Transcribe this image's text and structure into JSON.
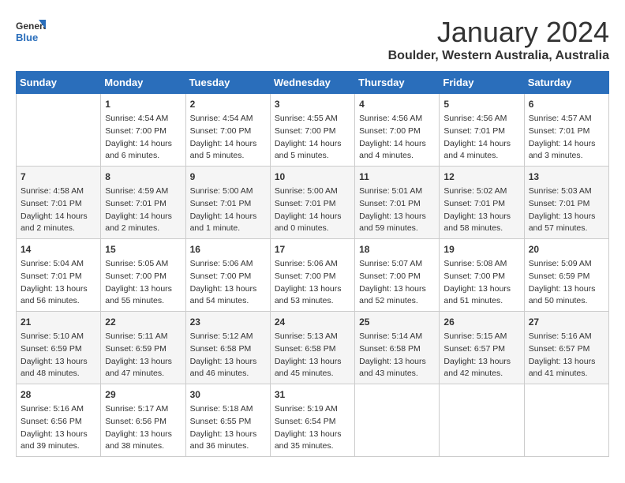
{
  "logo": {
    "line1": "General",
    "line2": "Blue"
  },
  "title": "January 2024",
  "location": "Boulder, Western Australia, Australia",
  "days_of_week": [
    "Sunday",
    "Monday",
    "Tuesday",
    "Wednesday",
    "Thursday",
    "Friday",
    "Saturday"
  ],
  "weeks": [
    [
      {
        "day": "",
        "info": ""
      },
      {
        "day": "1",
        "info": "Sunrise: 4:54 AM\nSunset: 7:00 PM\nDaylight: 14 hours\nand 6 minutes."
      },
      {
        "day": "2",
        "info": "Sunrise: 4:54 AM\nSunset: 7:00 PM\nDaylight: 14 hours\nand 5 minutes."
      },
      {
        "day": "3",
        "info": "Sunrise: 4:55 AM\nSunset: 7:00 PM\nDaylight: 14 hours\nand 5 minutes."
      },
      {
        "day": "4",
        "info": "Sunrise: 4:56 AM\nSunset: 7:00 PM\nDaylight: 14 hours\nand 4 minutes."
      },
      {
        "day": "5",
        "info": "Sunrise: 4:56 AM\nSunset: 7:01 PM\nDaylight: 14 hours\nand 4 minutes."
      },
      {
        "day": "6",
        "info": "Sunrise: 4:57 AM\nSunset: 7:01 PM\nDaylight: 14 hours\nand 3 minutes."
      }
    ],
    [
      {
        "day": "7",
        "info": "Sunrise: 4:58 AM\nSunset: 7:01 PM\nDaylight: 14 hours\nand 2 minutes."
      },
      {
        "day": "8",
        "info": "Sunrise: 4:59 AM\nSunset: 7:01 PM\nDaylight: 14 hours\nand 2 minutes."
      },
      {
        "day": "9",
        "info": "Sunrise: 5:00 AM\nSunset: 7:01 PM\nDaylight: 14 hours\nand 1 minute."
      },
      {
        "day": "10",
        "info": "Sunrise: 5:00 AM\nSunset: 7:01 PM\nDaylight: 14 hours\nand 0 minutes."
      },
      {
        "day": "11",
        "info": "Sunrise: 5:01 AM\nSunset: 7:01 PM\nDaylight: 13 hours\nand 59 minutes."
      },
      {
        "day": "12",
        "info": "Sunrise: 5:02 AM\nSunset: 7:01 PM\nDaylight: 13 hours\nand 58 minutes."
      },
      {
        "day": "13",
        "info": "Sunrise: 5:03 AM\nSunset: 7:01 PM\nDaylight: 13 hours\nand 57 minutes."
      }
    ],
    [
      {
        "day": "14",
        "info": "Sunrise: 5:04 AM\nSunset: 7:01 PM\nDaylight: 13 hours\nand 56 minutes."
      },
      {
        "day": "15",
        "info": "Sunrise: 5:05 AM\nSunset: 7:00 PM\nDaylight: 13 hours\nand 55 minutes."
      },
      {
        "day": "16",
        "info": "Sunrise: 5:06 AM\nSunset: 7:00 PM\nDaylight: 13 hours\nand 54 minutes."
      },
      {
        "day": "17",
        "info": "Sunrise: 5:06 AM\nSunset: 7:00 PM\nDaylight: 13 hours\nand 53 minutes."
      },
      {
        "day": "18",
        "info": "Sunrise: 5:07 AM\nSunset: 7:00 PM\nDaylight: 13 hours\nand 52 minutes."
      },
      {
        "day": "19",
        "info": "Sunrise: 5:08 AM\nSunset: 7:00 PM\nDaylight: 13 hours\nand 51 minutes."
      },
      {
        "day": "20",
        "info": "Sunrise: 5:09 AM\nSunset: 6:59 PM\nDaylight: 13 hours\nand 50 minutes."
      }
    ],
    [
      {
        "day": "21",
        "info": "Sunrise: 5:10 AM\nSunset: 6:59 PM\nDaylight: 13 hours\nand 48 minutes."
      },
      {
        "day": "22",
        "info": "Sunrise: 5:11 AM\nSunset: 6:59 PM\nDaylight: 13 hours\nand 47 minutes."
      },
      {
        "day": "23",
        "info": "Sunrise: 5:12 AM\nSunset: 6:58 PM\nDaylight: 13 hours\nand 46 minutes."
      },
      {
        "day": "24",
        "info": "Sunrise: 5:13 AM\nSunset: 6:58 PM\nDaylight: 13 hours\nand 45 minutes."
      },
      {
        "day": "25",
        "info": "Sunrise: 5:14 AM\nSunset: 6:58 PM\nDaylight: 13 hours\nand 43 minutes."
      },
      {
        "day": "26",
        "info": "Sunrise: 5:15 AM\nSunset: 6:57 PM\nDaylight: 13 hours\nand 42 minutes."
      },
      {
        "day": "27",
        "info": "Sunrise: 5:16 AM\nSunset: 6:57 PM\nDaylight: 13 hours\nand 41 minutes."
      }
    ],
    [
      {
        "day": "28",
        "info": "Sunrise: 5:16 AM\nSunset: 6:56 PM\nDaylight: 13 hours\nand 39 minutes."
      },
      {
        "day": "29",
        "info": "Sunrise: 5:17 AM\nSunset: 6:56 PM\nDaylight: 13 hours\nand 38 minutes."
      },
      {
        "day": "30",
        "info": "Sunrise: 5:18 AM\nSunset: 6:55 PM\nDaylight: 13 hours\nand 36 minutes."
      },
      {
        "day": "31",
        "info": "Sunrise: 5:19 AM\nSunset: 6:54 PM\nDaylight: 13 hours\nand 35 minutes."
      },
      {
        "day": "",
        "info": ""
      },
      {
        "day": "",
        "info": ""
      },
      {
        "day": "",
        "info": ""
      }
    ]
  ]
}
